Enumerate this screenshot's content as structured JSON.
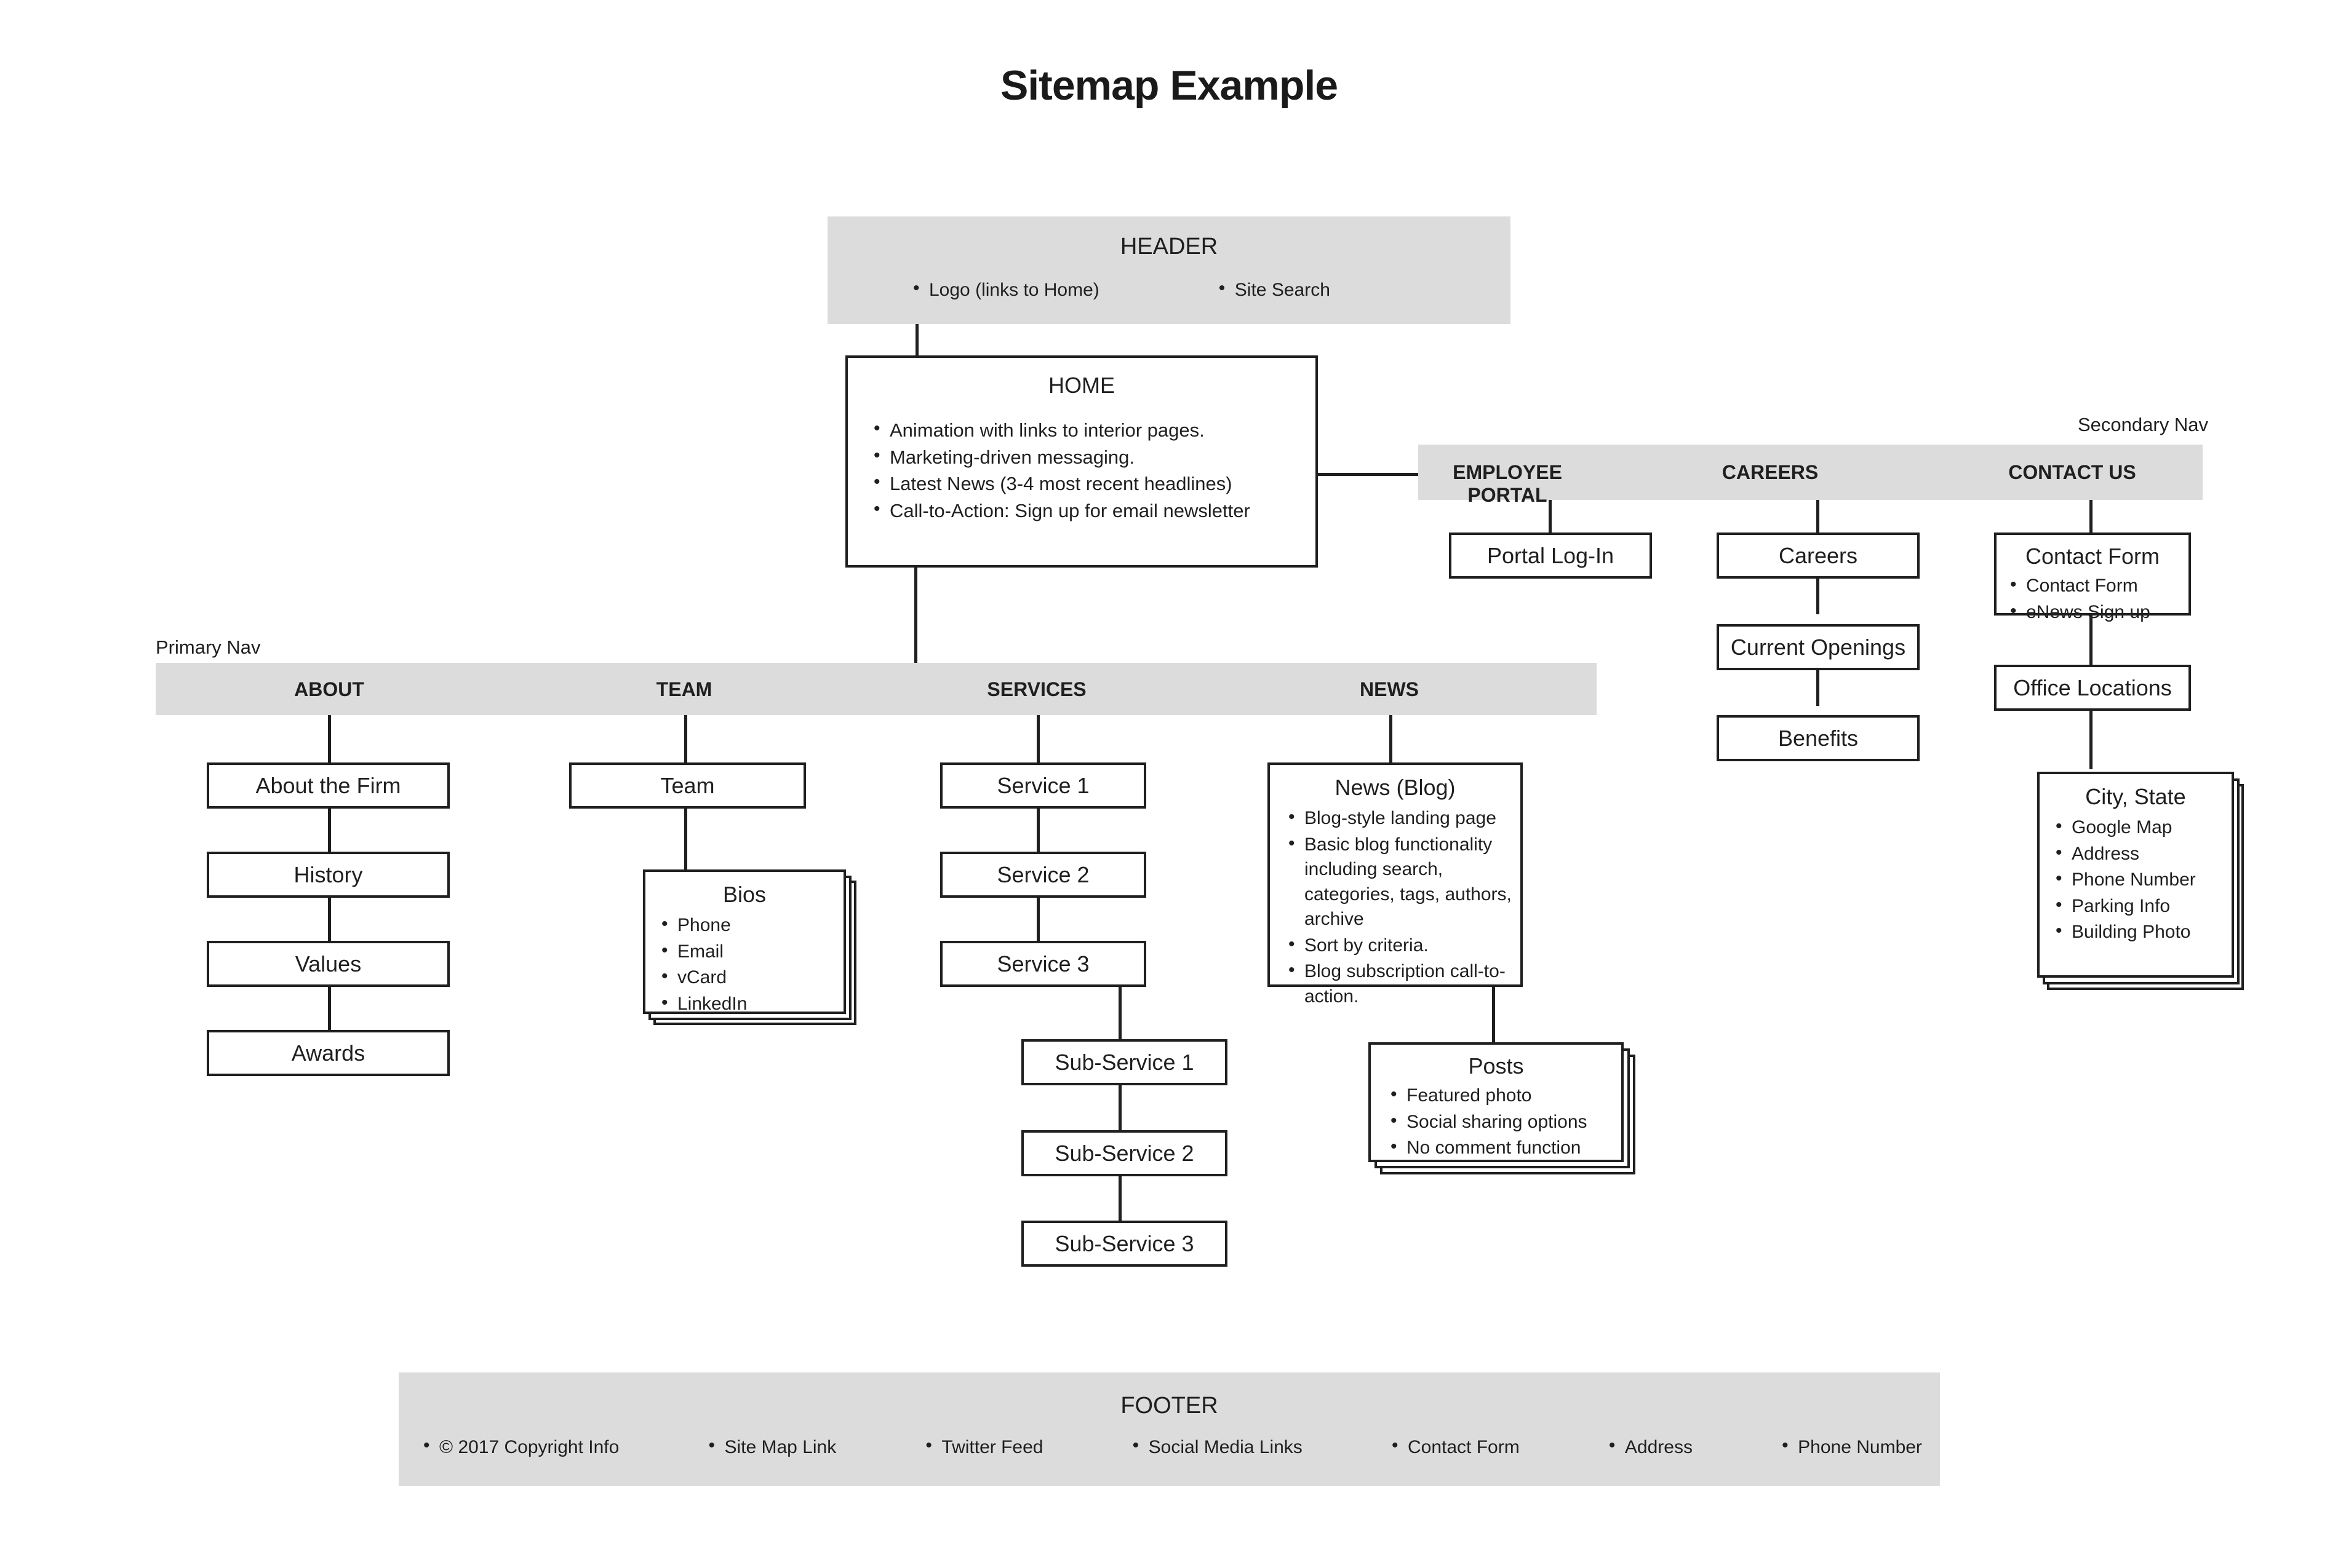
{
  "title": "Sitemap Example",
  "colors": {
    "band_fill": "#dcdcdc",
    "stroke": "#1f1f1f",
    "page_bg": "#ffffff"
  },
  "header": {
    "title": "HEADER",
    "items": [
      "Logo (links to Home)",
      "Site Search"
    ]
  },
  "home": {
    "title": "HOME",
    "items": [
      "Animation with links to interior pages.",
      "Marketing-driven messaging.",
      "Latest News (3-4 most recent headlines)",
      "Call-to-Action: Sign up for email newsletter"
    ]
  },
  "primary_nav": {
    "label": "Primary Nav",
    "items": [
      "ABOUT",
      "TEAM",
      "SERVICES",
      "NEWS"
    ]
  },
  "secondary_nav": {
    "label": "Secondary Nav",
    "items": [
      "EMPLOYEE PORTAL",
      "CAREERS",
      "CONTACT US"
    ]
  },
  "about_branch": {
    "nodes": [
      "About the Firm",
      "History",
      "Values",
      "Awards"
    ]
  },
  "team_branch": {
    "team": "Team",
    "bios": {
      "title": "Bios",
      "items": [
        "Phone",
        "Email",
        "vCard",
        "LinkedIn"
      ]
    }
  },
  "services_branch": {
    "services": [
      "Service 1",
      "Service 2",
      "Service 3"
    ],
    "sub_services": [
      "Sub-Service 1",
      "Sub-Service 2",
      "Sub-Service 3"
    ]
  },
  "news_branch": {
    "news": {
      "title": "News (Blog)",
      "items": [
        "Blog-style landing page",
        "Basic blog functionality including search, categories, tags, authors, archive",
        "Sort by criteria.",
        "Blog subscription call-to-action."
      ]
    },
    "posts": {
      "title": "Posts",
      "items": [
        "Featured photo",
        "Social sharing options",
        "No comment function"
      ]
    }
  },
  "employee_portal_branch": {
    "nodes": [
      "Portal Log-In"
    ]
  },
  "careers_branch": {
    "nodes": [
      "Careers",
      "Current Openings",
      "Benefits"
    ]
  },
  "contact_branch": {
    "contact_form": {
      "title": "Contact Form",
      "items": [
        "Contact Form",
        "eNews Sign up"
      ]
    },
    "office_locations": "Office Locations",
    "city_state": {
      "title": "City, State",
      "items": [
        "Google Map",
        "Address",
        "Phone Number",
        "Parking Info",
        "Building Photo"
      ]
    }
  },
  "footer": {
    "title": "FOOTER",
    "items": [
      "© 2017 Copyright Info",
      "Site Map Link",
      "Twitter Feed",
      "Social Media Links",
      "Contact Form",
      "Address",
      "Phone Number"
    ]
  }
}
